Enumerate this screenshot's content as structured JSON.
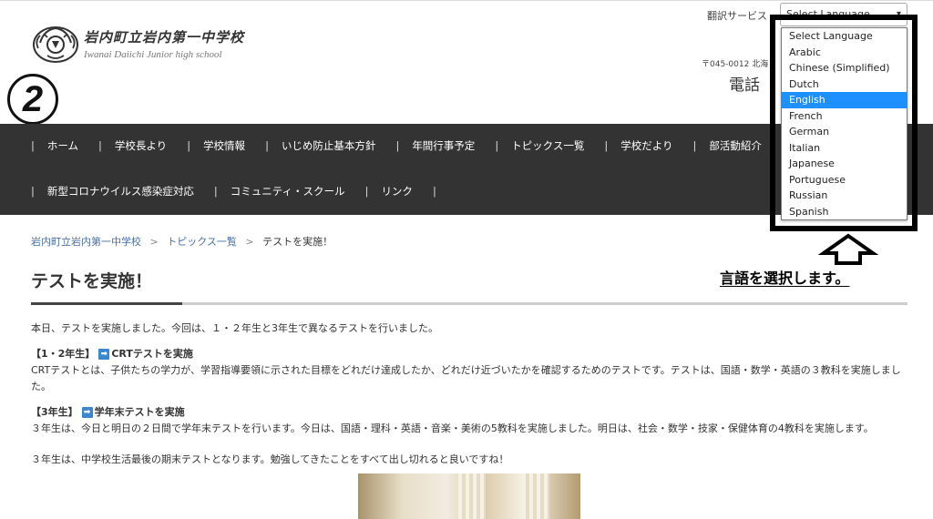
{
  "header": {
    "school_name_jp": "岩内町立岩内第一中学校",
    "school_name_en": "Iwanai Daiichi Junior high school",
    "postal": "〒045-0012 北海",
    "phone_label": "電話（"
  },
  "step_badge": "2",
  "translate": {
    "label": "翻訳サービス",
    "select_value": "Select Language",
    "options": [
      "Select Language",
      "Arabic",
      "Chinese (Simplified)",
      "Dutch",
      "English",
      "French",
      "German",
      "Italian",
      "Japanese",
      "Portuguese",
      "Russian",
      "Spanish"
    ],
    "highlighted": "English"
  },
  "nav": {
    "row1": [
      "ホーム",
      "学校長より",
      "学校情報",
      "いじめ防止基本方針",
      "年間行事予定",
      "トピックス一覧",
      "学校だより",
      "部活動紹介"
    ],
    "row2": [
      "新型コロナウイルス感染症対応",
      "コミュニティ・スクール",
      "リンク"
    ],
    "separator": "|"
  },
  "breadcrumb": {
    "items": [
      "岩内町立岩内第一中学校",
      "トピックス一覧",
      "テストを実施！"
    ],
    "separator": ">"
  },
  "page_title": "テストを実施！",
  "content": {
    "intro": "本日、テストを実施しました。今回は、１・２年生と3年生で異なるテストを行いました。",
    "sec1_label": "【1・2年生】",
    "sec1_title": "CRTテストを実施",
    "sec1_body": "CRTテストとは、子供たちの学力が、学習指導要領に示された目標をどれだけ達成したか、どれだけ近づいたかを確認するためのテストです。テストは、国語・数学・英語の３教科を実施しました。",
    "sec2_label": "【3年生】",
    "sec2_title": "学年末テストを実施",
    "sec2_body": "３年生は、今日と明日の２日間で学年末テストを行います。今日は、国語・理科・英語・音楽・美術の5教科を実施しました。明日は、社会・数学・技家・保健体育の4教科を実施します。",
    "closing": "３年生は、中学校生活最後の期末テストとなります。勉強してきたことをすべて出し切れると良いですね！"
  },
  "annotation": "言語を選択します。",
  "colors": {
    "nav_bg": "#333333",
    "highlight": "#1e90ff",
    "link": "#4a6fa5",
    "icon_blue": "#3a87cf"
  }
}
